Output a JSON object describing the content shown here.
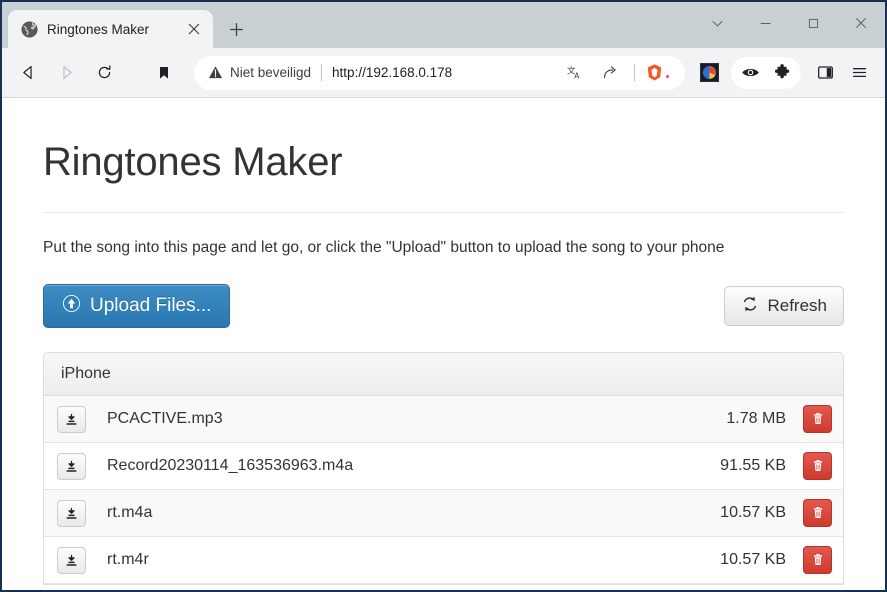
{
  "browser": {
    "tab": {
      "title": "Ringtones Maker",
      "favicon": "globe-icon",
      "close_label": "×"
    },
    "newtab_label": "+",
    "window_controls": {
      "tab_search": "tab-search-chevron",
      "minimize": "–",
      "maximize": "☐",
      "close": "✕"
    },
    "nav": {
      "back": "back-arrow-icon",
      "forward": "forward-arrow-icon",
      "reload": "reload-icon",
      "bookmark": "bookmark-icon"
    },
    "omnibox": {
      "security_warning": "Niet beveiligd",
      "url": "http://192.168.0.178",
      "translate": "translate-icon",
      "share": "share-icon",
      "brave_shields": "brave-lion-icon"
    },
    "toolbar_icons": {
      "extension_color": "colorful-extension-icon",
      "eye": "eye-icon",
      "puzzle": "puzzle-piece-icon",
      "sidebar": "sidebar-panel-icon",
      "menu": "hamburger-menu-icon"
    }
  },
  "page": {
    "title": "Ringtones Maker",
    "lead": "Put the song into this page and let go, or click the \"Upload\" button to upload the song to your phone",
    "upload_button": {
      "label": "Upload Files...",
      "icon": "upload-circle-arrow-icon",
      "color": "#2a77b1"
    },
    "refresh_button": {
      "label": "Refresh",
      "icon": "refresh-icon"
    },
    "panel": {
      "header": "iPhone",
      "rows": [
        {
          "name": "PCACTIVE.mp3",
          "size": "1.78 MB",
          "download_icon": "download-icon",
          "delete_icon": "trash-icon"
        },
        {
          "name": "Record20230114_163536963.m4a",
          "size": "91.55 KB",
          "download_icon": "download-icon",
          "delete_icon": "trash-icon"
        },
        {
          "name": "rt.m4a",
          "size": "10.57 KB",
          "download_icon": "download-icon",
          "delete_icon": "trash-icon"
        },
        {
          "name": "rt.m4r",
          "size": "10.57 KB",
          "download_icon": "download-icon",
          "delete_icon": "trash-icon"
        }
      ]
    }
  }
}
